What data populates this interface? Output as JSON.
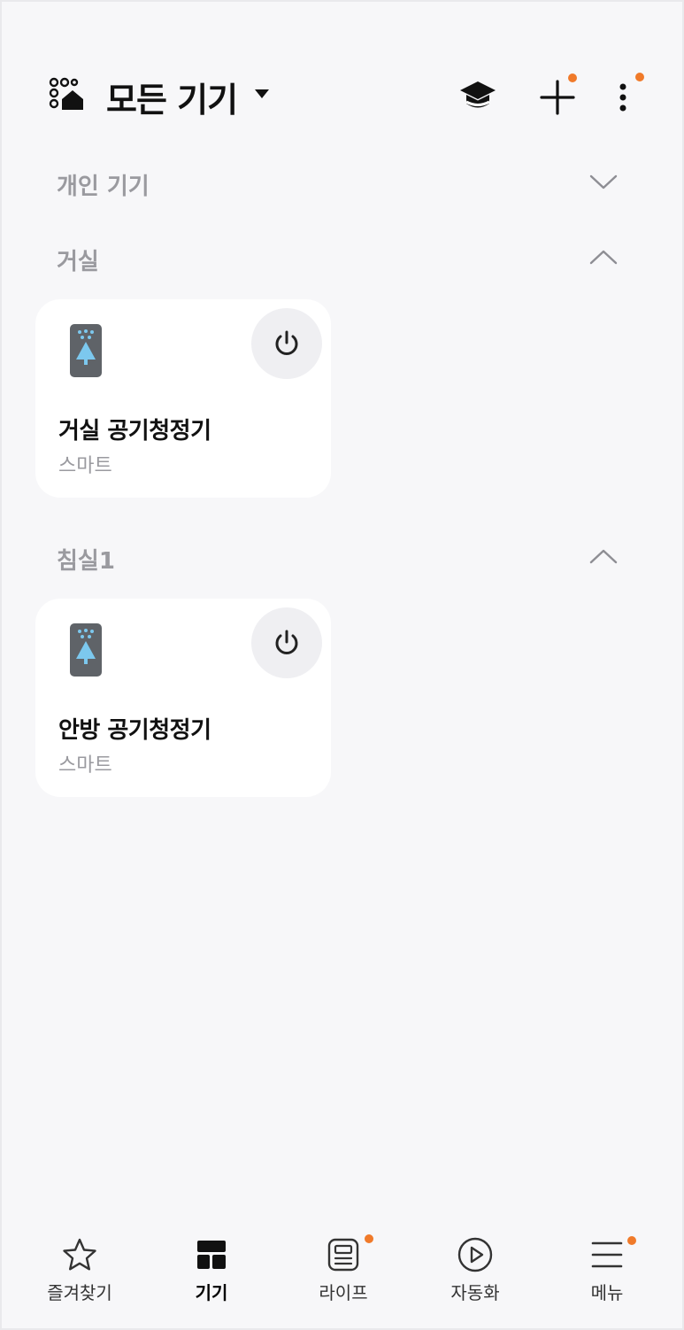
{
  "header": {
    "title": "모든 기기",
    "location_icon": "location-home-icon",
    "actions": [
      {
        "name": "guide-icon",
        "badge": false
      },
      {
        "name": "add-icon",
        "badge": true
      },
      {
        "name": "more-options-icon",
        "badge": true
      }
    ]
  },
  "sections": [
    {
      "label": "개인 기기",
      "state": "collapsed"
    },
    {
      "label": "거실",
      "state": "expanded"
    },
    {
      "label": "침실1",
      "state": "expanded"
    }
  ],
  "devices": [
    {
      "name": "거실 공기청정기",
      "status": "스마트",
      "icon": "air-purifier-icon",
      "room": "거실"
    },
    {
      "name": "안방 공기청정기",
      "status": "스마트",
      "icon": "air-purifier-icon",
      "room": "침실1"
    }
  ],
  "bottom_nav": [
    {
      "label": "즐겨찾기",
      "icon": "star-icon",
      "active": false,
      "badge": false
    },
    {
      "label": "기기",
      "icon": "devices-grid-icon",
      "active": true,
      "badge": false
    },
    {
      "label": "라이프",
      "icon": "life-icon",
      "active": false,
      "badge": true
    },
    {
      "label": "자동화",
      "icon": "play-circle-icon",
      "active": false,
      "badge": false
    },
    {
      "label": "메뉴",
      "icon": "menu-icon",
      "active": false,
      "badge": true
    }
  ],
  "colors": {
    "background": "#f7f7f9",
    "card": "#ffffff",
    "badge": "#f07a2a",
    "muted_text": "#9a9a9f",
    "device_icon_body": "#5f6368",
    "device_icon_accent": "#7cc8ee"
  }
}
